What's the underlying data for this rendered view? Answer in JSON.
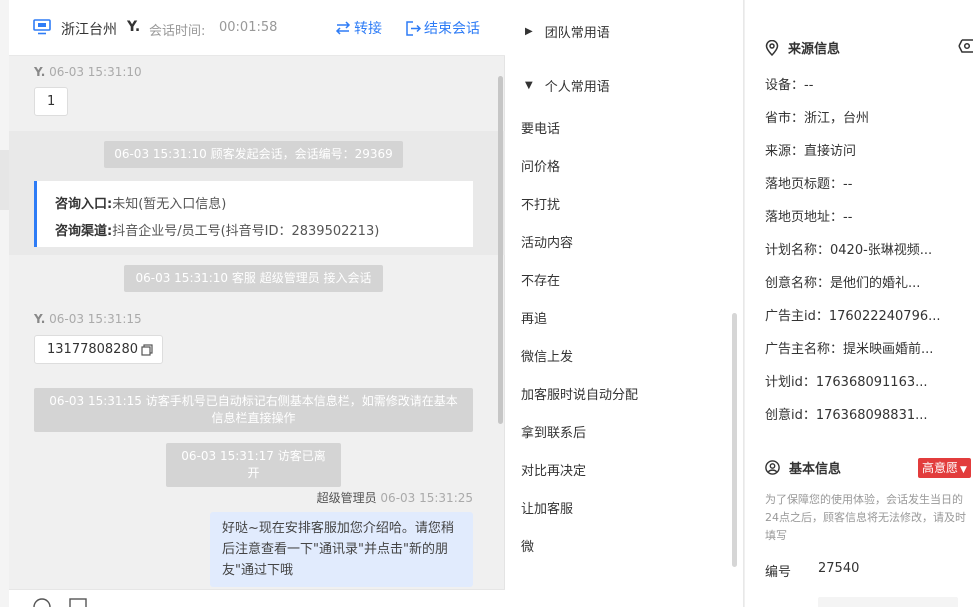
{
  "header": {
    "location": "浙江台州",
    "user": "Y.",
    "session_time_label": "会话时间:",
    "session_time": "00:01:58",
    "transfer_label": "转接",
    "end_label": "结束会话"
  },
  "messages": {
    "m1": {
      "sender": "Y.",
      "time": "06-03 15:31:10",
      "text": "1"
    },
    "sys1": "06-03 15:31:10 顾客发起会话，会话编号：29369",
    "entry": {
      "entry_label": "咨询入口:",
      "entry_value": "未知(暂无入口信息)",
      "channel_label": "咨询渠道:",
      "channel_value": "抖音企业号/员工号(抖音号ID：2839502213)"
    },
    "sys2": "06-03 15:31:10 客服 超级管理员 接入会话",
    "m2": {
      "sender": "Y.",
      "time": "06-03 15:31:15",
      "text": "13177808280"
    },
    "sys3": "06-03 15:31:15 访客手机号已自动标记右侧基本信息栏，如需修改请在基本信息栏直接操作",
    "sys4": "06-03 15:31:17 访客已离开",
    "agent": {
      "name": "超级管理员",
      "time": "06-03 15:31:25",
      "text": "好哒~现在安排客服加您介绍哈。请您稍后注意查看一下\"通讯录\"并点击\"新的朋友\"通过下哦"
    }
  },
  "phrases": {
    "team_group": "团队常用语",
    "personal_group": "个人常用语",
    "items": [
      "要电话",
      "问价格",
      "不打扰",
      "活动内容",
      "不存在",
      "再追",
      "微信上发",
      "加客服时说自动分配",
      "拿到联系后",
      "对比再决定",
      "让加客服",
      "微"
    ]
  },
  "source_info": {
    "title": "来源信息",
    "rows": [
      "设备：--",
      "省市：浙江，台州",
      "来源：直接访问",
      "落地页标题：--",
      "落地页地址：--",
      "计划名称：0420-张琳视频...",
      "创意名称：是他们的婚礼...",
      "广告主id：176022240796...",
      "广告主名称：提米映画婚前...",
      "计划id：176368091163...",
      "创意id：176368098831..."
    ]
  },
  "base_info": {
    "title": "基本信息",
    "intent": "高意愿",
    "notice": "为了保障您的使用体验，会话发生当日的24点之后，顾客信息将无法修改，请及时填写",
    "number_label": "编号",
    "number_value": "27540"
  },
  "colors": {
    "accent": "#2e7cf6",
    "intent_badge": "#e23c3c",
    "agent_bubble": "#e1ebfd",
    "system_msg": "#d4d4d4"
  }
}
